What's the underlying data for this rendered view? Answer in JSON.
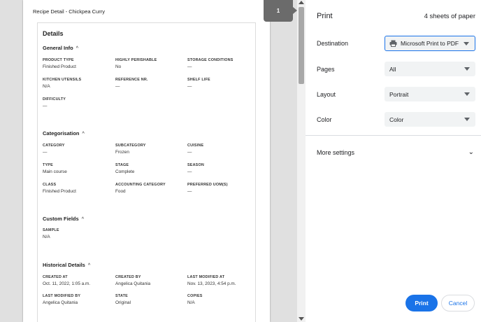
{
  "preview": {
    "doc_title": "Recipe Detail - Chickpea Curry",
    "page_badge": "1",
    "details_title": "Details",
    "sections": {
      "general": {
        "title": "General Info",
        "chev": "^",
        "fields": [
          {
            "label": "PRODUCT TYPE",
            "value": "Finished Product"
          },
          {
            "label": "HIGHLY PERISHABLE",
            "value": "No"
          },
          {
            "label": "STORAGE CONDITIONS",
            "value": "—"
          },
          {
            "label": "KITCHEN UTENSILS",
            "value": "N/A"
          },
          {
            "label": "REFERENCE NR.",
            "value": "—"
          },
          {
            "label": "SHELF LIFE",
            "value": "—"
          },
          {
            "label": "DIFFICULTY",
            "value": "—"
          }
        ]
      },
      "categorisation": {
        "title": "Categorisation",
        "chev": "^",
        "fields": [
          {
            "label": "CATEGORY",
            "value": "—"
          },
          {
            "label": "SUBCATEGORY",
            "value": "Frozen"
          },
          {
            "label": "CUISINE",
            "value": "—"
          },
          {
            "label": "TYPE",
            "value": "Main course"
          },
          {
            "label": "STAGE",
            "value": "Complete"
          },
          {
            "label": "SEASON",
            "value": "—"
          },
          {
            "label": "CLASS",
            "value": "Finished Product"
          },
          {
            "label": "ACCOUNTING CATEGORY",
            "value": "Food"
          },
          {
            "label": "PREFERRED UOM(S)",
            "value": "—"
          }
        ]
      },
      "custom": {
        "title": "Custom Fields",
        "chev": "^",
        "fields": [
          {
            "label": "SAMPLE",
            "value": "N/A"
          }
        ]
      },
      "historical": {
        "title": "Historical Details",
        "chev": "^",
        "fields": [
          {
            "label": "CREATED AT",
            "value": "Oct. 11, 2022, 1:05 a.m."
          },
          {
            "label": "CREATED BY",
            "value": "Angelica Quitania"
          },
          {
            "label": "LAST MODIFIED AT",
            "value": "Nov. 13, 2023, 4:54 p.m."
          },
          {
            "label": "LAST MODIFIED BY",
            "value": "Angelica Quitania"
          },
          {
            "label": "STATE",
            "value": "Original"
          },
          {
            "label": "COPIES",
            "value": "N/A"
          }
        ]
      }
    }
  },
  "panel": {
    "title": "Print",
    "sheet_count": "4 sheets of paper",
    "destination": {
      "label": "Destination",
      "value": "Microsoft Print to PDF",
      "icon": "printer-icon"
    },
    "pages": {
      "label": "Pages",
      "value": "All"
    },
    "layout": {
      "label": "Layout",
      "value": "Portrait"
    },
    "color": {
      "label": "Color",
      "value": "Color"
    },
    "more_settings": "More settings",
    "print_label": "Print",
    "cancel_label": "Cancel"
  },
  "colors": {
    "accent": "#1a73e8",
    "badge": "#6b6b6b"
  }
}
